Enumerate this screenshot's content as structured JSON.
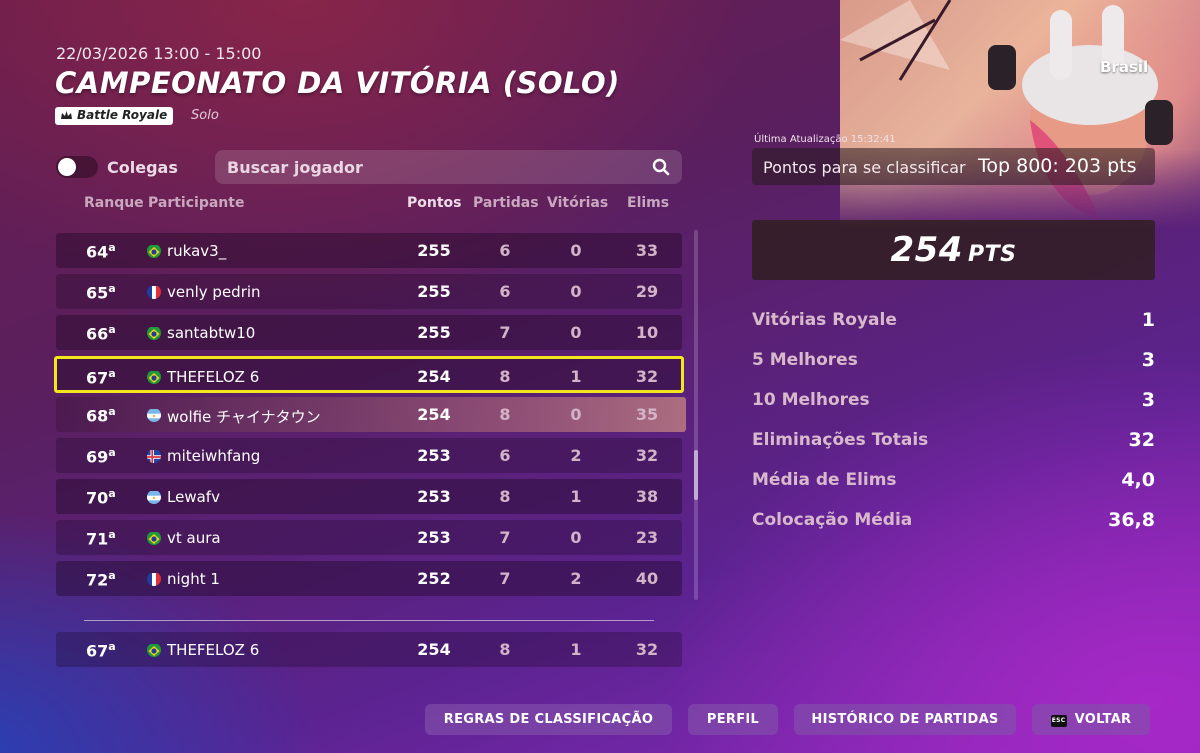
{
  "header": {
    "date": "22/03/2026 13:00 - 15:00",
    "title": "CAMPEONATO DA VITÓRIA (SOLO)",
    "mode_badge": "Battle Royale",
    "mode_sub": "Solo",
    "region": "Brasil"
  },
  "controls": {
    "toggle_label": "Colegas",
    "search_placeholder": "Buscar jogador"
  },
  "columns": {
    "rank": "Ranque",
    "participant": "Participante",
    "points": "Pontos",
    "matches": "Partidas",
    "wins": "Vitórias",
    "elims": "Elims"
  },
  "rows": [
    {
      "rank": "64",
      "ord": "a",
      "flag": "br",
      "name": "rukav3_",
      "points": "255",
      "matches": "6",
      "wins": "0",
      "elims": "33"
    },
    {
      "rank": "65",
      "ord": "a",
      "flag": "fr",
      "name": "venly pedrin",
      "points": "255",
      "matches": "6",
      "wins": "0",
      "elims": "29"
    },
    {
      "rank": "66",
      "ord": "a",
      "flag": "br",
      "name": "santabtw10",
      "points": "255",
      "matches": "7",
      "wins": "0",
      "elims": "10"
    },
    {
      "rank": "67",
      "ord": "a",
      "flag": "br",
      "name": "THEFELOZ 6",
      "points": "254",
      "matches": "8",
      "wins": "1",
      "elims": "32"
    },
    {
      "rank": "68",
      "ord": "a",
      "flag": "ar",
      "name": "wolfie チャイナタウン",
      "points": "254",
      "matches": "8",
      "wins": "0",
      "elims": "35"
    },
    {
      "rank": "69",
      "ord": "a",
      "flag": "is",
      "name": "miteiwhfang",
      "points": "253",
      "matches": "6",
      "wins": "2",
      "elims": "32"
    },
    {
      "rank": "70",
      "ord": "a",
      "flag": "ar",
      "name": "Lewafv",
      "points": "253",
      "matches": "8",
      "wins": "1",
      "elims": "38"
    },
    {
      "rank": "71",
      "ord": "a",
      "flag": "br",
      "name": "vt aura",
      "points": "253",
      "matches": "7",
      "wins": "0",
      "elims": "23"
    },
    {
      "rank": "72",
      "ord": "a",
      "flag": "fr",
      "name": "night 1",
      "points": "252",
      "matches": "7",
      "wins": "2",
      "elims": "40"
    }
  ],
  "self_row": {
    "rank": "67",
    "ord": "a",
    "flag": "br",
    "name": "THEFELOZ 6",
    "points": "254",
    "matches": "8",
    "wins": "1",
    "elims": "32"
  },
  "summary": {
    "last_update": "Última Atualização 15:32:41",
    "qual_label": "Pontos para se classificar",
    "qual_value": "Top 800: 203 pts",
    "score_value": "254",
    "score_unit": "PTS"
  },
  "stats": [
    {
      "label": "Vitórias Royale",
      "value": "1"
    },
    {
      "label": "5 Melhores",
      "value": "3"
    },
    {
      "label": "10 Melhores",
      "value": "3"
    },
    {
      "label": "Eliminações Totais",
      "value": "32"
    },
    {
      "label": "Média de Elims",
      "value": "4,0"
    },
    {
      "label": "Colocação Média",
      "value": "36,8"
    }
  ],
  "buttons": {
    "rules": "REGRAS DE CLASSIFICAÇÃO",
    "profile": "PERFIL",
    "history": "HISTÓRICO DE PARTIDAS",
    "back_key": "ESC",
    "back": "VOLTAR"
  },
  "icons": {
    "crown": "crown-icon",
    "search": "search-icon",
    "esc": "esc-key-icon"
  },
  "colors": {
    "highlight": "#f3e61d",
    "button_bg": "#8250aa"
  }
}
